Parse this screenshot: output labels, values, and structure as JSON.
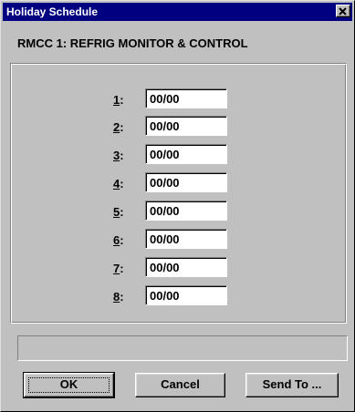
{
  "window": {
    "title": "Holiday Schedule",
    "close_icon": "close-icon"
  },
  "subtitle": "RMCC 1: REFRIG MONITOR & CONTROL",
  "rows": [
    {
      "number": "1",
      "suffix": ":",
      "value": "00/00"
    },
    {
      "number": "2",
      "suffix": ":",
      "value": "00/00"
    },
    {
      "number": "3",
      "suffix": ":",
      "value": "00/00"
    },
    {
      "number": "4",
      "suffix": ":",
      "value": "00/00"
    },
    {
      "number": "5",
      "suffix": ":",
      "value": "00/00"
    },
    {
      "number": "6",
      "suffix": ":",
      "value": "00/00"
    },
    {
      "number": "7",
      "suffix": ":",
      "value": "00/00"
    },
    {
      "number": "8",
      "suffix": ":",
      "value": "00/00"
    }
  ],
  "status_text": "",
  "buttons": {
    "ok": "OK",
    "cancel": "Cancel",
    "send_to": "Send To ..."
  },
  "colors": {
    "titlebar": "#000080",
    "face": "#c0c0c0",
    "field": "#ffffff"
  }
}
